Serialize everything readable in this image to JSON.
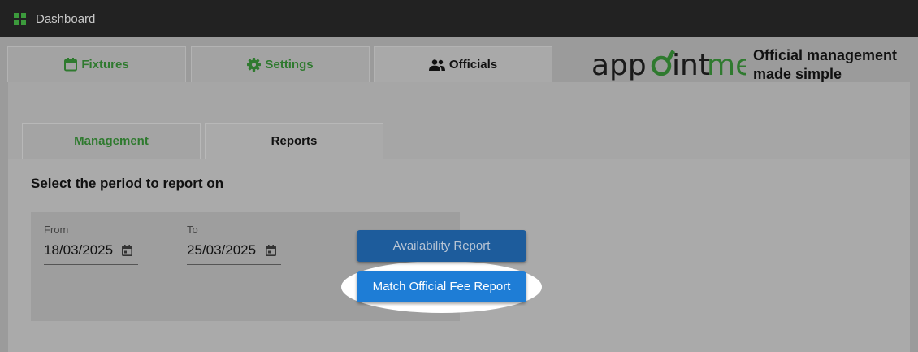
{
  "topbar": {
    "title": "Dashboard",
    "icon": "dashboard-grid-icon"
  },
  "main_tabs": [
    {
      "label": "Fixtures",
      "icon": "calendar-icon",
      "active": false
    },
    {
      "label": "Settings",
      "icon": "gear-icon",
      "active": false
    },
    {
      "label": "Officials",
      "icon": "people-icon",
      "active": true
    }
  ],
  "brand": {
    "logo_text": "appointme",
    "tagline_line1": "Official management",
    "tagline_line2": "made simple"
  },
  "sub_tabs": [
    {
      "label": "Management",
      "active": false
    },
    {
      "label": "Reports",
      "active": true
    }
  ],
  "report": {
    "heading": "Select the period to report on",
    "from": {
      "label": "From",
      "value": "18/03/2025"
    },
    "to": {
      "label": "To",
      "value": "25/03/2025"
    },
    "buttons": {
      "availability": "Availability Report",
      "match_fee": "Match Official Fee Report"
    }
  },
  "colors": {
    "green": "#2f7a2f",
    "button_blue": "#1e7dd6",
    "topbar": "#222222"
  }
}
